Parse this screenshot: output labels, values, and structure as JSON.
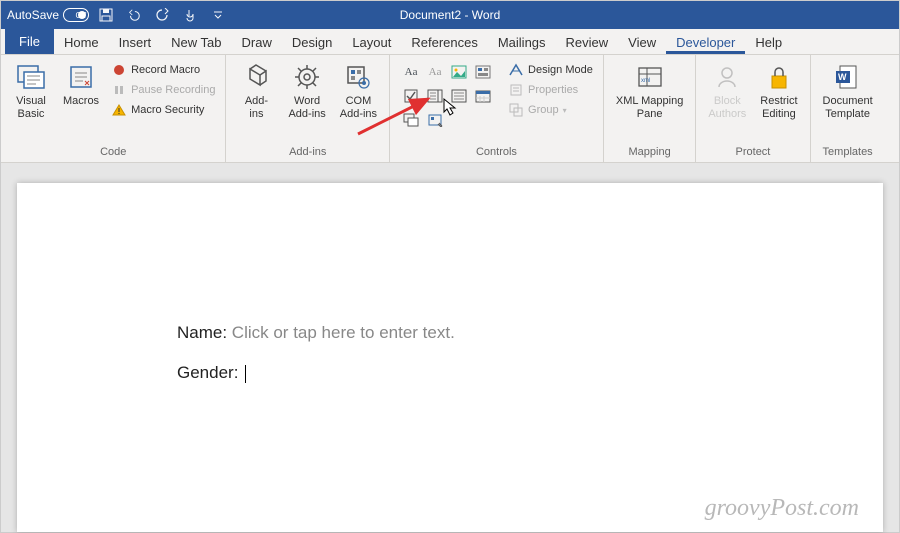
{
  "titlebar": {
    "autosave_label": "AutoSave",
    "autosave_state": "Off",
    "document_title": "Document2 - Word"
  },
  "tabs": {
    "file": "File",
    "items": [
      "Home",
      "Insert",
      "New Tab",
      "Draw",
      "Design",
      "Layout",
      "References",
      "Mailings",
      "Review",
      "View",
      "Developer",
      "Help"
    ],
    "active": "Developer"
  },
  "ribbon": {
    "code": {
      "label": "Code",
      "visual_basic": "Visual\nBasic",
      "macros": "Macros",
      "record_macro": "Record Macro",
      "pause_recording": "Pause Recording",
      "macro_security": "Macro Security"
    },
    "addins": {
      "label": "Add-ins",
      "addins": "Add-\nins",
      "word_addins": "Word\nAdd-ins",
      "com_addins": "COM\nAdd-ins"
    },
    "controls": {
      "label": "Controls",
      "design_mode": "Design Mode",
      "properties": "Properties",
      "group": "Group"
    },
    "mapping": {
      "label": "Mapping",
      "xml_mapping": "XML Mapping\nPane"
    },
    "protect": {
      "label": "Protect",
      "block_authors": "Block\nAuthors",
      "restrict_editing": "Restrict\nEditing"
    },
    "templates": {
      "label": "Templates",
      "document_template": "Document\nTemplate"
    }
  },
  "document": {
    "name_label": "Name: ",
    "name_placeholder": "Click or tap here to enter text.",
    "gender_label": "Gender: "
  },
  "watermark": "groovyPost.com"
}
